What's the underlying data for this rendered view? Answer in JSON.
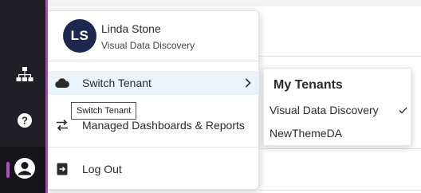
{
  "user": {
    "initials": "LS",
    "name": "Linda Stone",
    "tenant": "Visual Data Discovery"
  },
  "rail": {
    "icons": [
      "sitemap-icon",
      "help-icon",
      "user-account-icon"
    ]
  },
  "menu": {
    "items": [
      {
        "label": "Switch Tenant",
        "icon": "cloud-icon",
        "has_submenu": true,
        "highlighted": true
      },
      {
        "label": "Managed Dashboards & Reports",
        "icon": "swap-arrows-icon"
      },
      {
        "label": "Log Out",
        "icon": "logout-icon"
      }
    ]
  },
  "tooltip": {
    "text": "Switch Tenant"
  },
  "submenu": {
    "title": "My Tenants",
    "items": [
      {
        "label": "Visual Data Discovery",
        "selected": true
      },
      {
        "label": "NewThemeDA",
        "selected": false
      }
    ]
  },
  "colors": {
    "rail_bg": "#1f1f25",
    "accent": "#b14fc5",
    "avatar_bg": "#1d2750",
    "highlight": "#e9f3fb"
  }
}
